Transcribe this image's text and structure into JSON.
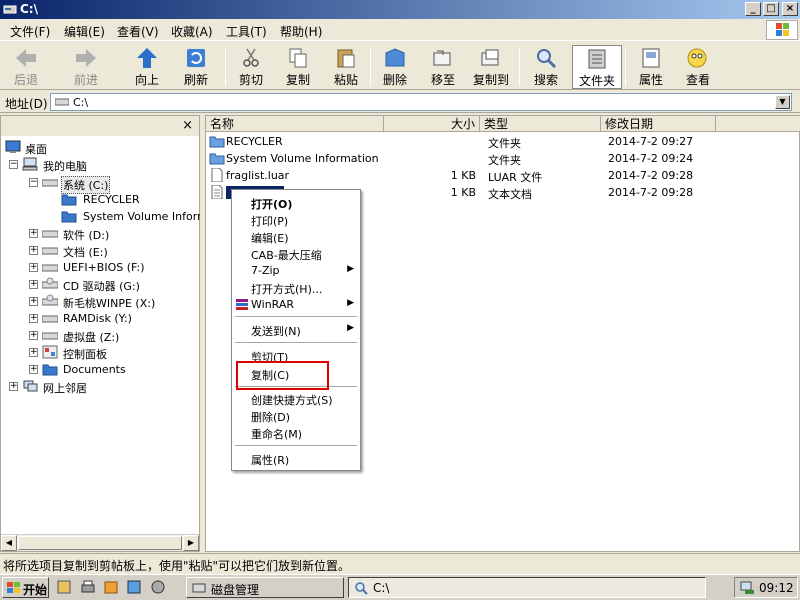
{
  "window": {
    "title": "C:\\",
    "controls": [
      "_",
      "□",
      "×"
    ]
  },
  "menubar": {
    "items": [
      "文件(F)",
      "编辑(E)",
      "查看(V)",
      "收藏(A)",
      "工具(T)",
      "帮助(H)"
    ]
  },
  "toolbar": {
    "buttons": [
      {
        "label": "后退",
        "icon": "back-arrow-icon",
        "enabled": false
      },
      {
        "label": "前进",
        "icon": "forward-arrow-icon",
        "enabled": false
      },
      {
        "label": "向上",
        "icon": "up-arrow-icon",
        "enabled": true
      },
      {
        "label": "刷新",
        "icon": "refresh-icon",
        "enabled": true
      },
      {
        "label": "剪切",
        "icon": "scissors-icon",
        "enabled": true
      },
      {
        "label": "复制",
        "icon": "copy-icon",
        "enabled": true
      },
      {
        "label": "粘贴",
        "icon": "paste-icon",
        "enabled": true
      },
      {
        "label": "删除",
        "icon": "delete-icon",
        "enabled": true
      },
      {
        "label": "移至",
        "icon": "move-to-icon",
        "enabled": true
      },
      {
        "label": "复制到",
        "icon": "copy-to-icon",
        "enabled": true
      },
      {
        "label": "搜索",
        "icon": "search-icon",
        "enabled": true
      },
      {
        "label": "文件夹",
        "icon": "folders-icon",
        "enabled": true,
        "pressed": true
      },
      {
        "label": "属性",
        "icon": "properties-icon",
        "enabled": true
      },
      {
        "label": "查看",
        "icon": "view-icon",
        "enabled": true
      }
    ]
  },
  "address": {
    "label": "地址(D)",
    "value": "C:\\"
  },
  "tree": {
    "close": "×",
    "items": [
      {
        "label": "桌面",
        "icon": "desktop-icon"
      },
      {
        "label": "我的电脑",
        "icon": "my-computer-icon"
      },
      {
        "label": "系统 (C:)",
        "icon": "drive-icon",
        "selected": true
      },
      {
        "label": "RECYCLER",
        "icon": "folder-icon"
      },
      {
        "label": "System Volume Informat",
        "icon": "folder-icon"
      },
      {
        "label": "软件 (D:)",
        "icon": "drive-icon"
      },
      {
        "label": "文档 (E:)",
        "icon": "drive-icon"
      },
      {
        "label": "UEFI+BIOS (F:)",
        "icon": "drive-icon"
      },
      {
        "label": "CD 驱动器 (G:)",
        "icon": "cd-drive-icon"
      },
      {
        "label": "新毛桃WINPE (X:)",
        "icon": "cd-drive-icon"
      },
      {
        "label": "RAMDisk (Y:)",
        "icon": "drive-icon"
      },
      {
        "label": "虚拟盘 (Z:)",
        "icon": "drive-icon"
      },
      {
        "label": "控制面板",
        "icon": "control-panel-icon"
      },
      {
        "label": "Documents",
        "icon": "folder-icon"
      },
      {
        "label": "网上邻居",
        "icon": "network-icon"
      }
    ]
  },
  "list": {
    "columns": [
      "名称",
      "大小",
      "类型",
      "修改日期"
    ],
    "rows": [
      {
        "name": "RECYCLER",
        "size": "",
        "type": "文件夹",
        "date": "2014-7-2 09:27",
        "icon": "folder-icon"
      },
      {
        "name": "System Volume Information",
        "size": "",
        "type": "文件夹",
        "date": "2014-7-2 09:24",
        "icon": "folder-icon"
      },
      {
        "name": "fraglist.luar",
        "size": "1 KB",
        "type": "LUAR 文件",
        "date": "2014-7-2 09:28",
        "icon": "file-icon"
      },
      {
        "name": "",
        "size": "1 KB",
        "type": "文本文档",
        "date": "2014-7-2 09:28",
        "icon": "text-file-icon",
        "selected": true
      }
    ]
  },
  "context_menu": {
    "items": [
      {
        "label": "打开(O)",
        "bold": true
      },
      {
        "label": "打印(P)"
      },
      {
        "label": "编辑(E)"
      },
      {
        "label": "CAB-最大压缩"
      },
      {
        "label": "7-Zip",
        "submenu": true
      },
      {
        "label": "打开方式(H)..."
      },
      {
        "label": "WinRAR",
        "submenu": true,
        "icon": "winrar-icon"
      },
      {
        "label": "发送到(N)",
        "submenu": true
      },
      {
        "label": "剪切(T)"
      },
      {
        "label": "复制(C)",
        "highlighted": true
      },
      {
        "label": "创建快捷方式(S)"
      },
      {
        "label": "删除(D)"
      },
      {
        "label": "重命名(M)"
      },
      {
        "label": "属性(R)"
      }
    ],
    "arrow": "▶",
    "highlight_color": "#e00000"
  },
  "status": {
    "text": "将所选项目复制到剪帖板上，使用\"粘贴\"可以把它们放到新位置。"
  },
  "taskbar": {
    "start_label": "开始",
    "tasks": [
      {
        "label": "磁盘管理",
        "icon": "disk-management-icon",
        "active": false
      },
      {
        "label": "C:\\",
        "icon": "search-folder-icon",
        "active": true
      }
    ],
    "clock": "09:12"
  },
  "colors": {
    "title_gradient_start": "#0a246a",
    "title_gradient_end": "#a6caf0",
    "selection": "#0a246a",
    "face": "#ece9d8"
  }
}
